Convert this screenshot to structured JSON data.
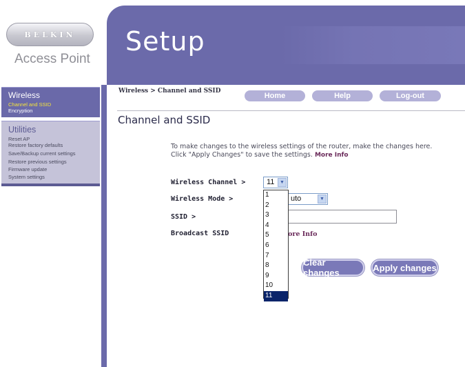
{
  "brand": {
    "logo_text": "BELKIN",
    "product": "Access Point"
  },
  "banner": {
    "title": "Setup"
  },
  "sidebar": {
    "sections": [
      {
        "title": "Wireless",
        "items": [
          {
            "label": "Channel and SSID",
            "active": true
          },
          {
            "label": "Encryption",
            "active": false
          }
        ]
      },
      {
        "title": "Utilities",
        "items": [
          {
            "label": "Reset AP"
          },
          {
            "label": "Restore factory defaults"
          },
          {
            "label": "Save/Backup current settings"
          },
          {
            "label": "Restore previous settings"
          },
          {
            "label": "Firmware update"
          },
          {
            "label": "System settings"
          }
        ]
      }
    ]
  },
  "breadcrumb": "Wireless > Channel and SSID",
  "top_nav": {
    "home": "Home",
    "help": "Help",
    "logout": "Log-out"
  },
  "main": {
    "title": "Channel and SSID",
    "intro": "To make changes to the wireless settings of the router, make the changes here. Click \"Apply Changes\" to save the settings.",
    "intro_more": "More Info",
    "fields": {
      "channel_label": "Wireless Channel >",
      "channel_value": "11",
      "mode_label": "Wireless Mode >",
      "mode_value_visible": "uto",
      "ssid_label": "SSID >",
      "broadcast_label": "Broadcast SSID",
      "broadcast_more_visible": "ore Info"
    },
    "channel_options": [
      "1",
      "2",
      "3",
      "4",
      "5",
      "6",
      "7",
      "8",
      "9",
      "10",
      "11"
    ],
    "channel_selected": "11",
    "buttons": {
      "clear": "Clear changes",
      "apply": "Apply changes"
    }
  },
  "colors": {
    "nav_purple": "#6b6aaa",
    "nav_light": "#c5c3d9",
    "active_item": "#f5e43a",
    "link_maroon": "#6a2a5a"
  }
}
